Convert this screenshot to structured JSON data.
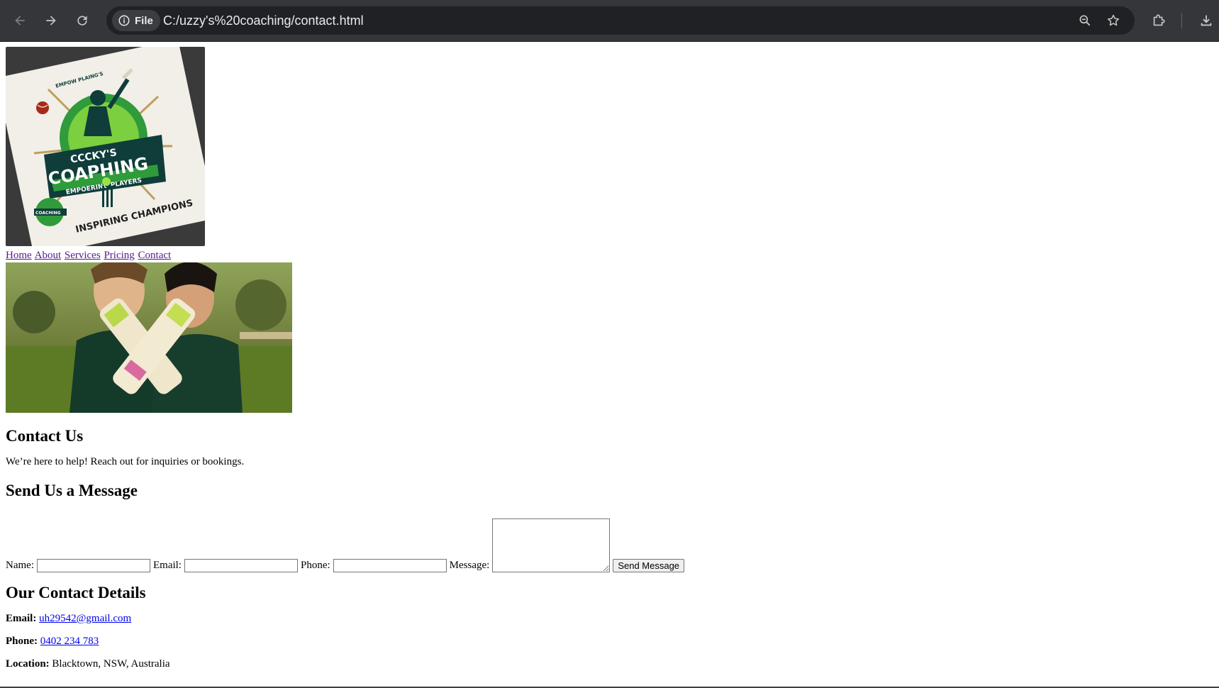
{
  "browser": {
    "site_chip_label": "File",
    "url": "C:/uzzy's%20coaching/contact.html"
  },
  "header": {
    "logo_text_top": "EMPOW PLAING'S",
    "logo_text_main_1": "CCCKY'S",
    "logo_text_main_2": "COAPHING",
    "logo_text_ribbon": "EMPOERING PLAYERS",
    "logo_text_bottom": "INSPIRING CHAMPIONS",
    "logo_text_small": "COACHING"
  },
  "nav": {
    "items": [
      "Home",
      "About",
      "Services",
      "Pricing",
      "Contact"
    ]
  },
  "main": {
    "title": "Contact Us",
    "intro": "We’re here to help! Reach out for inquiries or bookings.",
    "form_heading": "Send Us a Message",
    "form": {
      "name_label": "Name:",
      "email_label": "Email:",
      "phone_label": "Phone:",
      "message_label": "Message:",
      "name_value": "",
      "email_value": "",
      "phone_value": "",
      "message_value": "",
      "submit_label": "Send Message"
    },
    "details_heading": "Our Contact Details",
    "details": {
      "email_label": "Email:",
      "email_value": "uh29542@gmail.com",
      "phone_label": "Phone:",
      "phone_value": "0402 234 783",
      "location_label": "Location:",
      "location_value": "Blacktown, NSW, Australia"
    }
  },
  "colors": {
    "chrome_bg": "#35363a",
    "omnibox_bg": "#202124",
    "visited_link": "#551a8b",
    "link": "#0000ee",
    "logo_green": "#2e8b2e",
    "logo_dark": "#0f3d3a"
  }
}
